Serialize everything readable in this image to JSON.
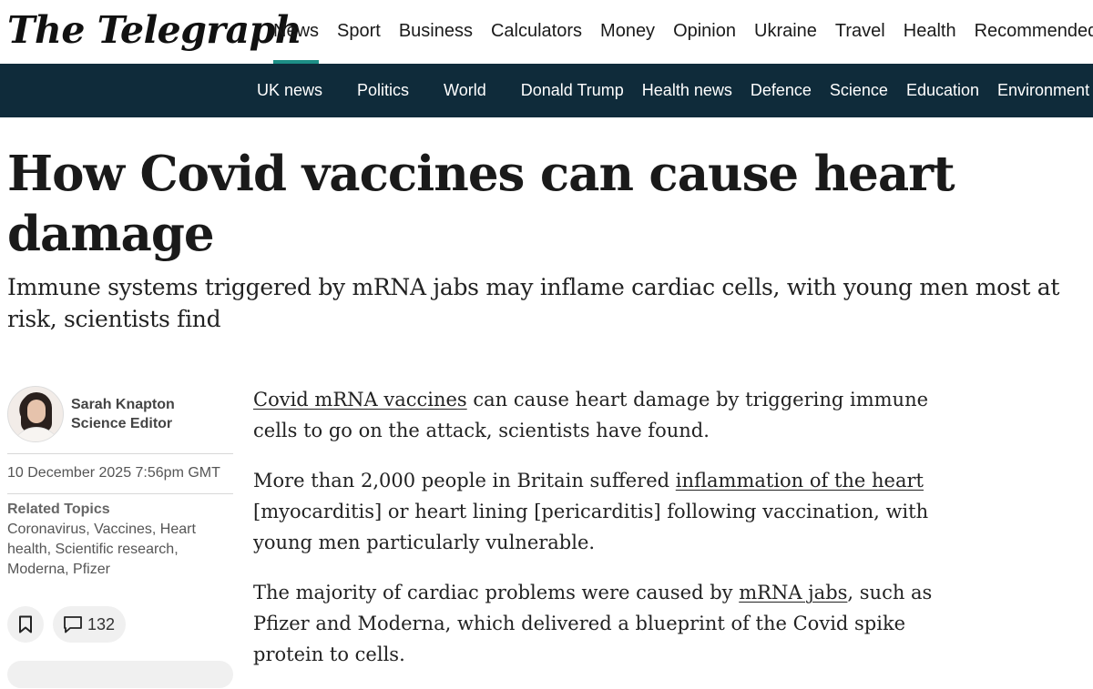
{
  "masthead": {
    "logo": "The Telegraph",
    "nav": [
      "News",
      "Sport",
      "Business",
      "Calculators",
      "Money",
      "Opinion",
      "Ukraine",
      "Travel",
      "Health",
      "Recommended"
    ],
    "active_nav": "News",
    "accent_color": "#1d8f86"
  },
  "subnav": {
    "items": [
      "UK news",
      "Politics",
      "World",
      "Donald Trump",
      "Health news",
      "Defence",
      "Science",
      "Education",
      "Environment"
    ],
    "background": "#0f2b3a"
  },
  "article": {
    "headline": "How Covid vaccines can cause heart damage",
    "standfirst": "Immune systems triggered by mRNA jabs may inflame cardiac cells, with young men most at risk, scientists find",
    "author": {
      "name": "Sarah Knapton",
      "role": "Science Editor"
    },
    "date": "10 December 2025 7:56pm GMT",
    "related_topics_label": "Related Topics",
    "related_topics": [
      "Coronavirus",
      "Vaccines",
      "Heart health",
      "Scientific research",
      "Moderna",
      "Pfizer"
    ],
    "comment_count": "132",
    "paragraphs": [
      {
        "link": "Covid mRNA vaccines",
        "text_after": " can cause heart damage by triggering immune cells to go on the attack, scientists have found."
      },
      {
        "text_before": "More than 2,000 people in Britain suffered ",
        "link": "inflammation of the heart",
        "text_after": " [myocarditis] or heart lining [pericarditis] following vaccination, with young men particularly vulnerable."
      },
      {
        "text_before": "The majority of cardiac problems were caused by ",
        "link": "mRNA jabs",
        "text_after": ", such as Pfizer and Moderna, which delivered a blueprint of the Covid spike protein to cells."
      }
    ]
  }
}
